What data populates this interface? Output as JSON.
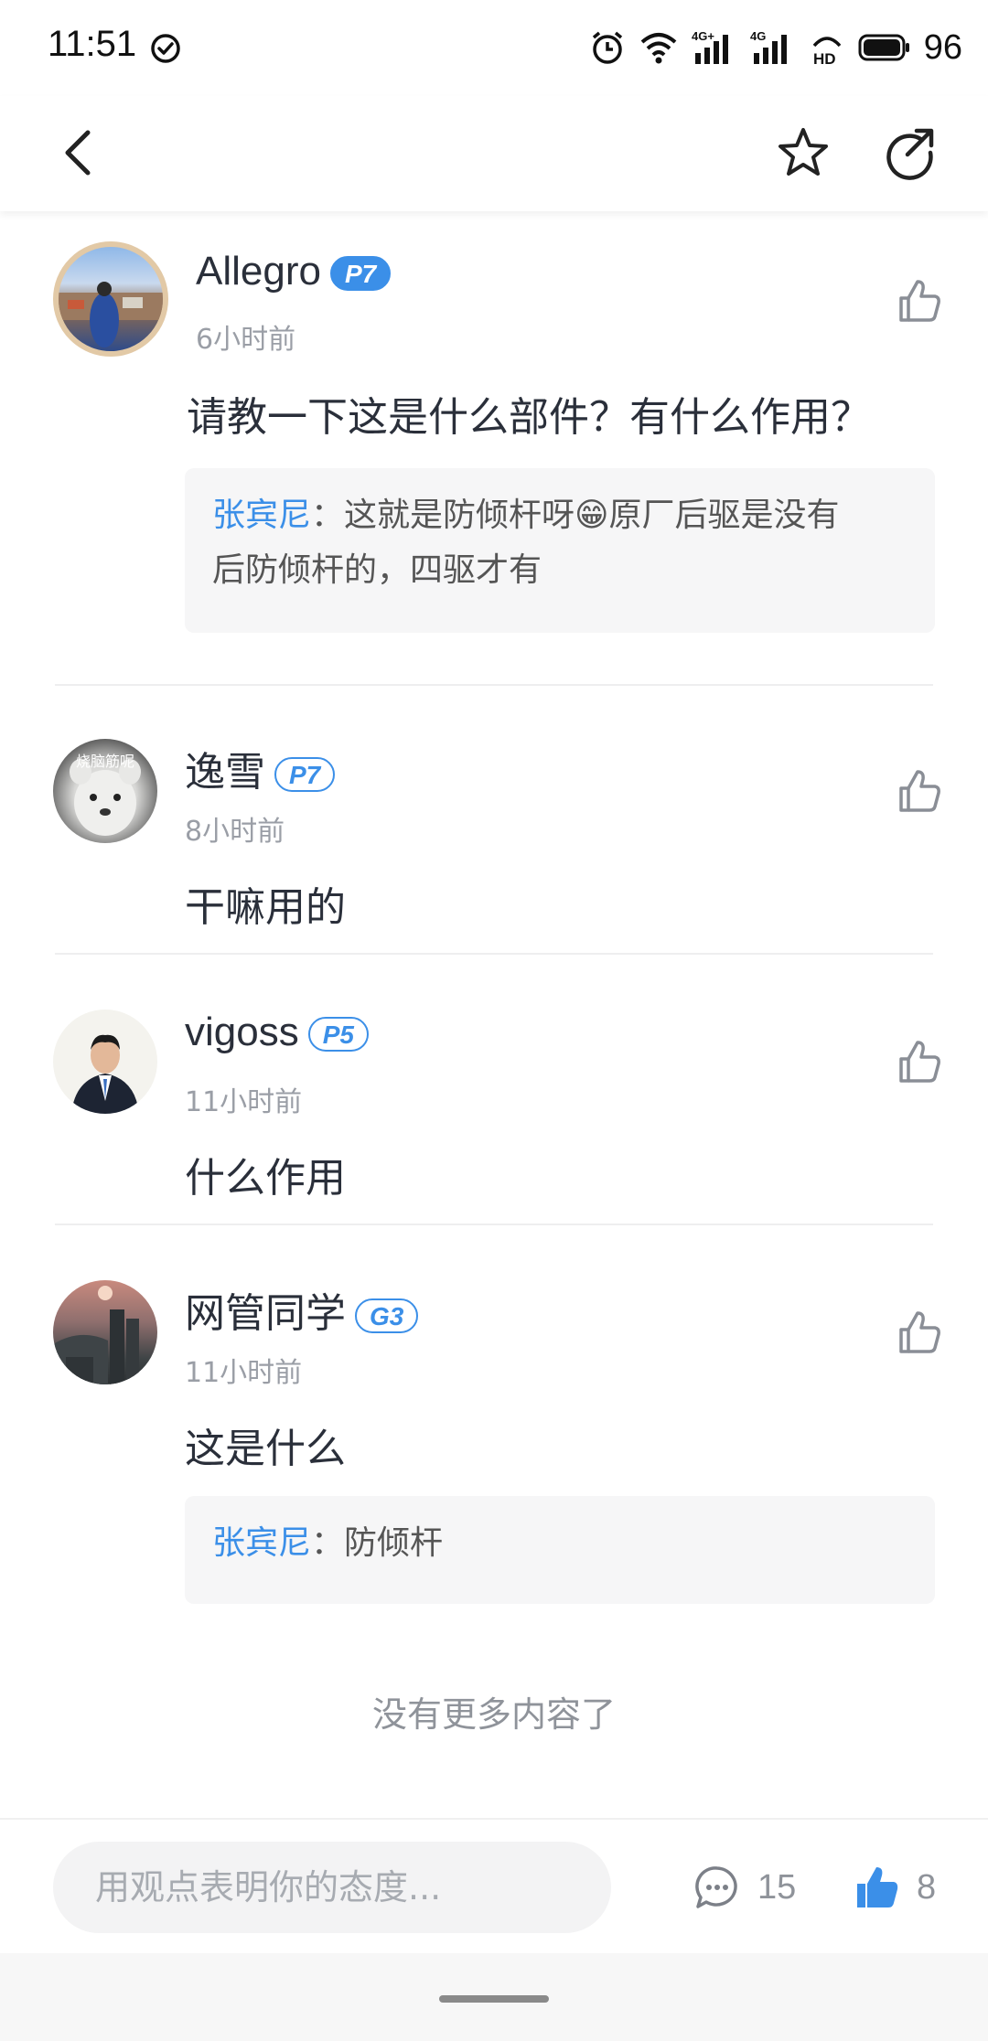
{
  "status_bar": {
    "time": "11:51",
    "battery": "96",
    "network_1": "4G+",
    "network_2": "4G",
    "hd": "HD"
  },
  "nav": {
    "back_icon": "chevron-left-icon",
    "favorite_icon": "star-icon",
    "share_icon": "share-icon"
  },
  "comments": [
    {
      "user": "Allegro",
      "level": "P7",
      "level_style": "solid",
      "time": "6小时前",
      "text": "请教一下这是什么部件？有什么作用？",
      "reply": {
        "author": "张宾尼",
        "separator": "：",
        "line1": "这就是防倾杆呀😁原厂后驱是没有",
        "line2": "后防倾杆的，四驱才有"
      }
    },
    {
      "user": "逸雪",
      "level": "P7",
      "level_style": "outline",
      "time": "8小时前",
      "text": "干嘛用的",
      "avatar_caption": "烧脑筋呢"
    },
    {
      "user": "vigoss",
      "level": "P5",
      "level_style": "outline",
      "time": "11小时前",
      "text": "什么作用"
    },
    {
      "user": "网管同学",
      "level": "G3",
      "level_style": "outline",
      "time": "11小时前",
      "text": "这是什么",
      "reply": {
        "author": "张宾尼",
        "separator": "：",
        "line1": "防倾杆"
      }
    }
  ],
  "footer_note": "没有更多内容了",
  "bottom_bar": {
    "input_placeholder": "用观点表明你的态度...",
    "comment_count": "15",
    "like_count": "8"
  },
  "colors": {
    "accent": "#3b8fe8",
    "text_primary": "#2a2f3a",
    "text_secondary": "#9a9ea6",
    "reply_bg": "#f6f6f7"
  }
}
